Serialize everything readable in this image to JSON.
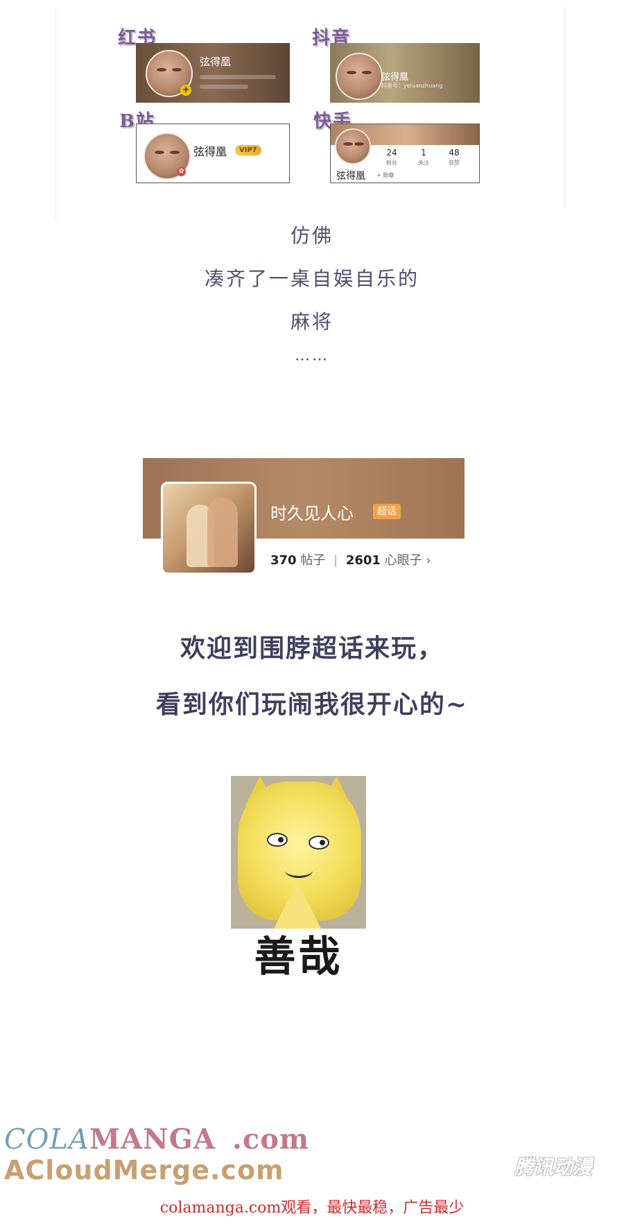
{
  "cards": [
    {
      "tag": "红书",
      "name": "弦得凰"
    },
    {
      "tag": "抖音",
      "name": "弦得凰",
      "sub": "抖音号：yeluanzhuang"
    },
    {
      "tag": "B站",
      "name": "弦得凰",
      "vip": "VIP7"
    },
    {
      "tag": "快手",
      "name": "弦得凰",
      "medal": "+ 勋章",
      "stats": [
        {
          "value": "24",
          "label": "粉丝"
        },
        {
          "value": "1",
          "label": "关注"
        },
        {
          "value": "48",
          "label": "获赞"
        }
      ]
    }
  ],
  "caption1": {
    "lines": [
      "仿佛",
      "凑齐了一桌自娱自乐的",
      "麻将",
      "……"
    ]
  },
  "super_topic": {
    "title": "时久见人心",
    "badge": "超话",
    "posts_count": "370",
    "posts_label": "帖子",
    "members_count": "2601",
    "members_label": "心眼子",
    "chevron": "›"
  },
  "caption2": {
    "lines": [
      "欢迎到围脖超话来玩，",
      "看到你们玩闹我很开心的~"
    ]
  },
  "meme": {
    "caption": "善哉"
  },
  "watermarks": {
    "colamanga_a": "COLA",
    "colamanga_b": "MANGA",
    "colamanga_c": ".com",
    "acloud": "ACloudMerge.com",
    "tencent": "腾讯动漫"
  },
  "footer": {
    "text": "colamanga.com观看，最快最稳，广告最少"
  },
  "colors": {
    "caption": "#4e4e6e",
    "footer": "#d22a2a",
    "banner": "#b48a66",
    "topic_badge": "#f0a24a"
  }
}
